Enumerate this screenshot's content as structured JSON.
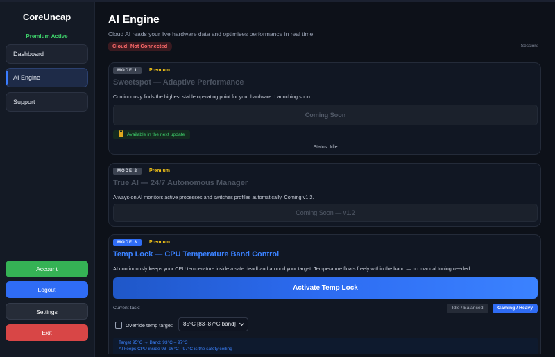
{
  "app": {
    "name": "CoreUncap",
    "premium_status": "Premium Active"
  },
  "nav": {
    "items": [
      {
        "label": "Dashboard",
        "active": false
      },
      {
        "label": "AI Engine",
        "active": true
      },
      {
        "label": "Support",
        "active": false
      }
    ]
  },
  "sidebar_actions": {
    "account": "Account",
    "logout": "Logout",
    "settings": "Settings",
    "exit": "Exit"
  },
  "colors": {
    "accent": "#3b82ff",
    "success": "#3ecf6a",
    "danger": "#d84646",
    "premium": "#f5c518",
    "background": "#0d1119"
  },
  "header": {
    "title": "AI Engine",
    "subtitle": "Cloud AI reads your live hardware data and optimises performance in real time.",
    "cloud_status": "Cloud: Not Connected",
    "session": "Session: —"
  },
  "modes": [
    {
      "tag": "MODE 1",
      "tier": "Premium",
      "title": "Sweetspot — Adaptive Performance",
      "description": "Continuously finds the highest stable operating point for your hardware. Launching soon.",
      "button": "Coming Soon",
      "availability": "Available in the next update",
      "availability_icon": "lock-icon",
      "status": "Status: Idle"
    },
    {
      "tag": "MODE 2",
      "tier": "Premium",
      "title": "True AI — 24/7 Autonomous Manager",
      "description": "Always-on AI monitors active processes and switches profiles automatically. Coming v1.2.",
      "button": "Coming Soon — v1.2"
    },
    {
      "tag": "MODE 3",
      "tier": "Premium",
      "title": "Temp Lock — CPU Temperature Band Control",
      "description": "AI continuously keeps your CPU temperature inside a safe deadband around your target. Temperature floats freely within the band — no manual tuning needed.",
      "button": "Activate Temp Lock",
      "current_task_label": "Current task:",
      "task_options": [
        "Idle / Balanced",
        "Gaming / Heavy"
      ],
      "task_selected": "Gaming / Heavy",
      "override_label": "Override temp target:",
      "override_checked": false,
      "target_select_value": "85°C  [83–87°C band]",
      "info_line_1": "Target 95°C  →  Band: 93°C – 97°C",
      "info_line_2": "AI keeps CPU inside 93–96°C · 97°C is the safety ceiling"
    }
  ]
}
